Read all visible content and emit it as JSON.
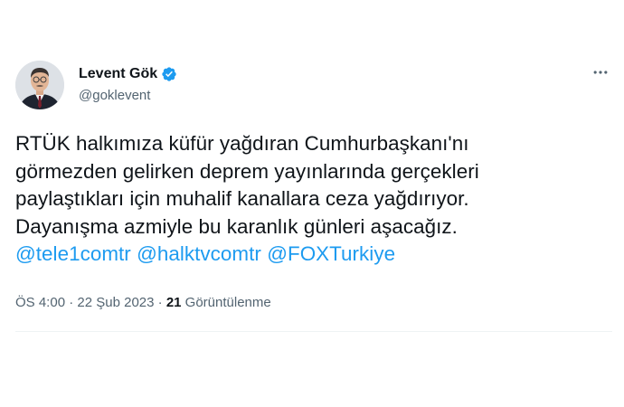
{
  "author": {
    "display_name": "Levent Gök",
    "handle": "@goklevent",
    "verified": true
  },
  "tweet": {
    "text_lines": [
      "RTÜK halkımıza küfür yağdıran Cumhurbaşkanı'nı",
      "görmezden gelirken deprem yayınlarında gerçekleri",
      "paylaştıkları için muhalif kanallara ceza yağdırıyor.",
      "Dayanışma azmiyle bu karanlık günleri aşacağız."
    ],
    "mentions": [
      "@tele1comtr",
      "@halktvcomtr",
      "@FOXTurkiye"
    ]
  },
  "meta": {
    "time": "ÖS 4:00",
    "separator": "·",
    "date": "22 Şub 2023",
    "views_count": "21",
    "views_label": "Görüntülenme"
  },
  "colors": {
    "accent": "#1d9bf0",
    "secondary_text": "#536471",
    "primary_text": "#0f1419"
  },
  "icons": {
    "verified": "verified-badge-icon",
    "more": "more-horizontal-icon"
  }
}
